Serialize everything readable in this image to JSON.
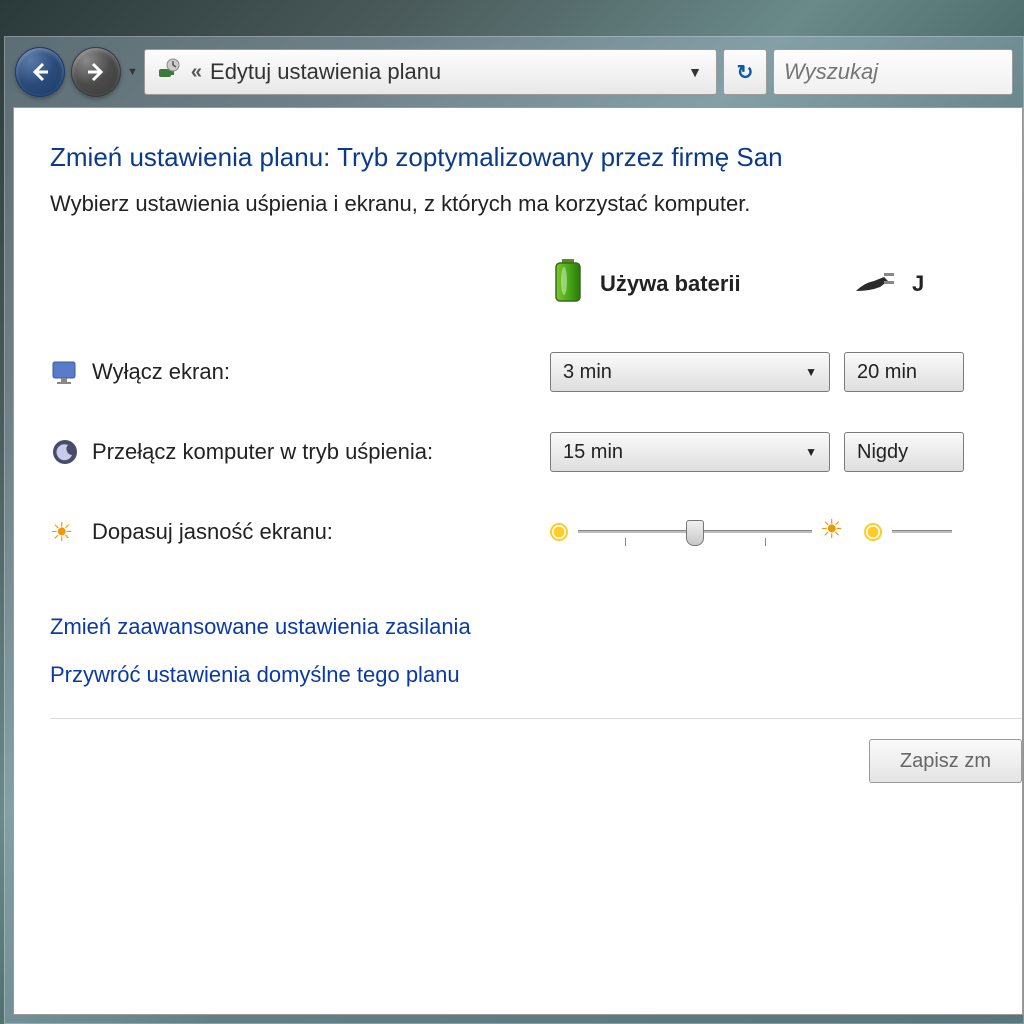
{
  "nav": {
    "breadcrumb_prefix": "«",
    "breadcrumb": "Edytuj ustawienia planu"
  },
  "search": {
    "placeholder": "Wyszukaj"
  },
  "page": {
    "title": "Zmień ustawienia planu: Tryb zoptymalizowany przez firmę San",
    "subtitle": "Wybierz ustawienia uśpienia i ekranu, z których ma korzystać komputer."
  },
  "columns": {
    "battery": "Używa baterii",
    "plugged": "J"
  },
  "rows": {
    "display_off": {
      "label": "Wyłącz ekran:",
      "battery": "3 min",
      "plugged": "20 min"
    },
    "sleep": {
      "label": "Przełącz komputer w tryb uśpienia:",
      "battery": "15 min",
      "plugged": "Nigdy"
    },
    "brightness": {
      "label": "Dopasuj jasność ekranu:"
    }
  },
  "links": {
    "advanced": "Zmień zaawansowane ustawienia zasilania",
    "restore": "Przywróć ustawienia domyślne tego planu"
  },
  "buttons": {
    "save": "Zapisz zm"
  }
}
